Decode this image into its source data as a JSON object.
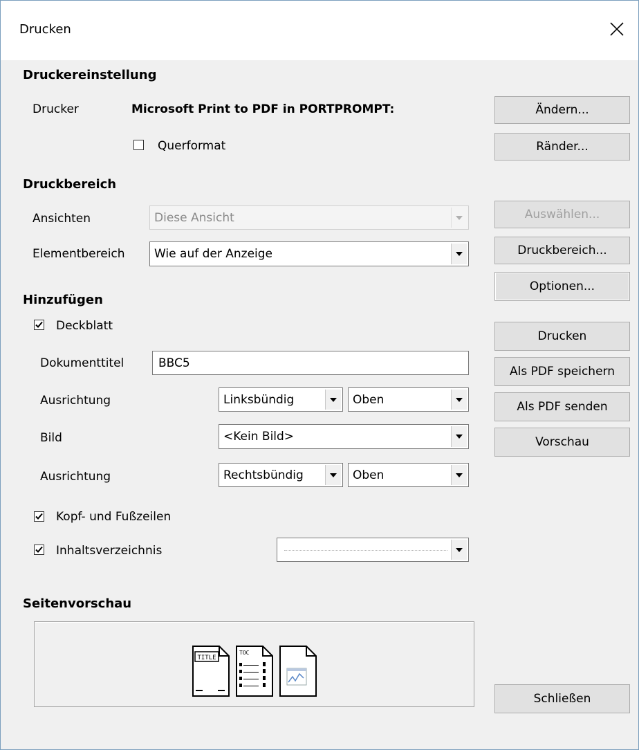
{
  "window": {
    "title": "Drucken"
  },
  "printer_settings": {
    "heading": "Druckereinstellung",
    "printer_label": "Drucker",
    "printer_name": "Microsoft Print to PDF in PORTPROMPT:",
    "landscape_label": "Querformat",
    "landscape_checked": false
  },
  "print_range": {
    "heading": "Druckbereich",
    "views_label": "Ansichten",
    "views_value": "Diese Ansicht",
    "element_label": "Elementbereich",
    "element_value": "Wie auf der Anzeige"
  },
  "add": {
    "heading": "Hinzufügen",
    "cover_label": "Deckblatt",
    "cover_checked": true,
    "doc_title_label": "Dokumenttitel",
    "doc_title_value": "BBC5",
    "align1_label": "Ausrichtung",
    "align1_h": "Linksbündig",
    "align1_v": "Oben",
    "image_label": "Bild",
    "image_value": "<Kein Bild>",
    "align2_label": "Ausrichtung",
    "align2_h": "Rechtsbündig",
    "align2_v": "Oben",
    "header_footer_label": "Kopf- und Fußzeilen",
    "header_footer_checked": true,
    "toc_label": "Inhaltsverzeichnis",
    "toc_checked": true,
    "toc_value": ""
  },
  "page_preview": {
    "heading": "Seitenvorschau",
    "icons": [
      "title-page-icon",
      "toc-page-icon",
      "chart-page-icon"
    ],
    "title_icon_text": "TITLE",
    "toc_icon_text": "TOC"
  },
  "buttons": {
    "change": "Ändern...",
    "margins": "Ränder...",
    "select": "Auswählen...",
    "print_range": "Druckbereich...",
    "options": "Optionen...",
    "print": "Drucken",
    "save_pdf": "Als PDF speichern",
    "send_pdf": "Als PDF senden",
    "preview": "Vorschau",
    "close": "Schließen"
  }
}
